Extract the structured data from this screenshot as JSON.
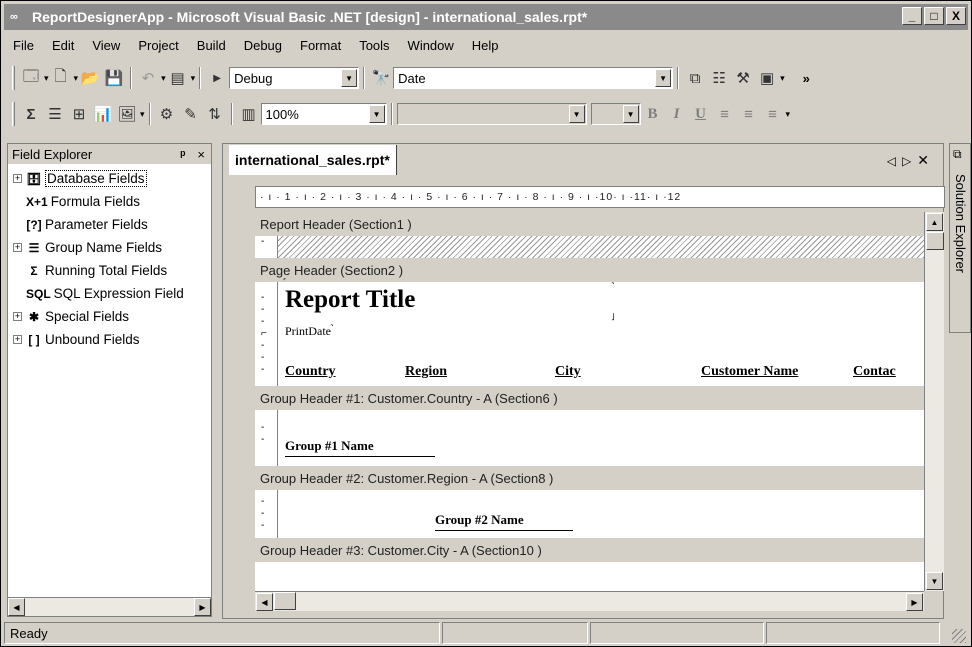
{
  "title": {
    "app": "ReportDesignerApp - Microsoft Visual Basic .NET [design] - international_sales.rpt*",
    "icon": "vs-icon"
  },
  "window_buttons": {
    "minimize": "_",
    "maximize": "□",
    "close": "X"
  },
  "menu": [
    {
      "label": "File"
    },
    {
      "label": "Edit"
    },
    {
      "label": "View"
    },
    {
      "label": "Project"
    },
    {
      "label": "Build"
    },
    {
      "label": "Debug"
    },
    {
      "label": "Format"
    },
    {
      "label": "Tools"
    },
    {
      "label": "Window"
    },
    {
      "label": "Help"
    }
  ],
  "toolbar1": {
    "config": "Debug",
    "find": "Date"
  },
  "toolbar2": {
    "zoom": "100%",
    "font": "",
    "size": ""
  },
  "format_buttons": {
    "bold": "B",
    "italic": "I",
    "underline": "U"
  },
  "field_explorer": {
    "title": "Field Explorer",
    "pin": "ᵖ",
    "close": "×",
    "items": [
      {
        "label": "Database Fields",
        "icon": "database-icon",
        "glyph": "🗄",
        "expand": "+"
      },
      {
        "label": "Formula Fields",
        "icon": "formula-icon",
        "glyph": "X+1",
        "expand": ""
      },
      {
        "label": "Parameter Fields",
        "icon": "parameter-icon",
        "glyph": "[?]",
        "expand": ""
      },
      {
        "label": "Group Name Fields",
        "icon": "group-icon",
        "glyph": "☰",
        "expand": "+"
      },
      {
        "label": "Running Total Fields",
        "icon": "sigma-icon",
        "glyph": "Σ",
        "expand": ""
      },
      {
        "label": "SQL Expression Field",
        "icon": "sql-icon",
        "glyph": "SQL",
        "expand": ""
      },
      {
        "label": "Special Fields",
        "icon": "special-icon",
        "glyph": "✱",
        "expand": "+"
      },
      {
        "label": "Unbound Fields",
        "icon": "unbound-icon",
        "glyph": "[ ]",
        "expand": "+"
      }
    ]
  },
  "doc": {
    "tab": "international_sales.rpt*",
    "ruler": "· ı · 1 · ı · 2 · ı · 3 · ı · 4 · ı · 5 · ı · 6 · ı · 7 · ı · 8 · ı · 9 · ı ·10· ı ·11· ı ·12",
    "sections": {
      "report_header": "Report Header  (Section1 )",
      "page_header": "Page Header  (Section2 )",
      "group1": "Group Header #1: Customer.Country - A (Section6 )",
      "group2": "Group Header #2: Customer.Region - A (Section8 )",
      "group3": "Group Header #3: Customer.City - A (Section10 )"
    },
    "report_title": "Report Title",
    "print_date": "PrintDate",
    "columns": [
      "Country",
      "Region",
      "City",
      "Customer Name",
      "Contac"
    ],
    "group1_name": "Group #1 Name",
    "group2_name": "Group #2 Name"
  },
  "solution_explorer": "Solution Explorer",
  "status": {
    "text": "Ready"
  }
}
